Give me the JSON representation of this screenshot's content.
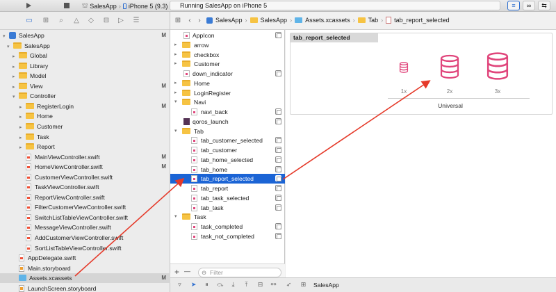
{
  "toolbar": {
    "scheme_app": "SalesApp",
    "scheme_device": "iPhone 5 (9.3)",
    "status": "Running SalesApp on iPhone 5"
  },
  "navigator": {
    "items": [
      {
        "label": "SalesApp",
        "kind": "project",
        "mark": "M"
      },
      {
        "label": "SalesApp",
        "kind": "folder",
        "mark": ""
      },
      {
        "label": "Global",
        "kind": "folder",
        "mark": ""
      },
      {
        "label": "Library",
        "kind": "folder",
        "mark": ""
      },
      {
        "label": "Model",
        "kind": "folder",
        "mark": ""
      },
      {
        "label": "View",
        "kind": "folder",
        "mark": "M"
      },
      {
        "label": "Controller",
        "kind": "folder",
        "mark": ""
      },
      {
        "label": "RegisterLogin",
        "kind": "folder",
        "mark": "M"
      },
      {
        "label": "Home",
        "kind": "folder",
        "mark": ""
      },
      {
        "label": "Customer",
        "kind": "folder",
        "mark": ""
      },
      {
        "label": "Task",
        "kind": "folder",
        "mark": ""
      },
      {
        "label": "Report",
        "kind": "folder",
        "mark": ""
      },
      {
        "label": "MainViewController.swift",
        "kind": "swift",
        "mark": "M"
      },
      {
        "label": "HomeViewController.swift",
        "kind": "swift",
        "mark": "M"
      },
      {
        "label": "CustomerViewController.swift",
        "kind": "swift",
        "mark": ""
      },
      {
        "label": "TaskViewController.swift",
        "kind": "swift",
        "mark": ""
      },
      {
        "label": "ReportViewController.swift",
        "kind": "swift",
        "mark": ""
      },
      {
        "label": "FilterCustomerViewController.swift",
        "kind": "swift",
        "mark": ""
      },
      {
        "label": "SwitchListTableViewController.swift",
        "kind": "swift",
        "mark": ""
      },
      {
        "label": "MessageViewController.swift",
        "kind": "swift",
        "mark": ""
      },
      {
        "label": "AddCustomerViewController.swift",
        "kind": "swift",
        "mark": ""
      },
      {
        "label": "SortListTableViewController.swift",
        "kind": "swift",
        "mark": ""
      },
      {
        "label": "AppDelegate.swift",
        "kind": "swift",
        "mark": ""
      },
      {
        "label": "Main.storyboard",
        "kind": "storyboard",
        "mark": ""
      },
      {
        "label": "Assets.xcassets",
        "kind": "assets",
        "mark": "M"
      },
      {
        "label": "LaunchScreen.storyboard",
        "kind": "storyboard",
        "mark": ""
      }
    ]
  },
  "jumpbar": {
    "crumbs": [
      "SalesApp",
      "SalesApp",
      "Assets.xcassets",
      "Tab",
      "tab_report_selected"
    ]
  },
  "assets": {
    "items": [
      {
        "label": "AppIcon"
      },
      {
        "label": "arrow"
      },
      {
        "label": "checkbox"
      },
      {
        "label": "Customer"
      },
      {
        "label": "down_indicator"
      },
      {
        "label": "Home"
      },
      {
        "label": "LoginRegister"
      },
      {
        "label": "Navi"
      },
      {
        "label": "navi_back"
      },
      {
        "label": "qoros_launch"
      },
      {
        "label": "Tab"
      },
      {
        "label": "tab_customer_selected"
      },
      {
        "label": "tab_customer"
      },
      {
        "label": "tab_home_selected"
      },
      {
        "label": "tab_home"
      },
      {
        "label": "tab_report_selected"
      },
      {
        "label": "tab_report"
      },
      {
        "label": "tab_task_selected"
      },
      {
        "label": "tab_task"
      },
      {
        "label": "Task"
      },
      {
        "label": "task_completed"
      },
      {
        "label": "task_not_completed"
      }
    ],
    "filter_placeholder": "Filter",
    "add_label": "+",
    "remove_label": "—"
  },
  "detail": {
    "title": "tab_report_selected",
    "slots": [
      "1x",
      "2x",
      "3x"
    ],
    "idiom": "Universal",
    "accent": "#e0457b"
  },
  "debugbar": {
    "target": "SalesApp"
  }
}
